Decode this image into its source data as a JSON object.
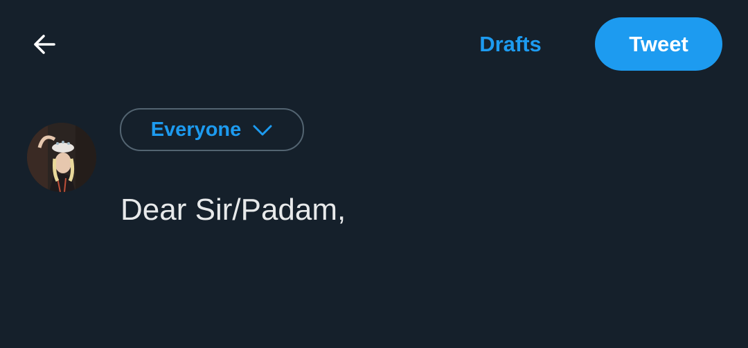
{
  "header": {
    "back_icon": "arrow-left-icon",
    "drafts_label": "Drafts",
    "tweet_label": "Tweet"
  },
  "composer": {
    "avatar_icon": "user-avatar",
    "audience_label": "Everyone",
    "audience_icon": "chevron-down-icon",
    "text": "Dear Sir/Padam,"
  },
  "colors": {
    "background": "#15202b",
    "accent": "#1d9bf0",
    "text": "#e7e9ea",
    "border": "#536471"
  }
}
